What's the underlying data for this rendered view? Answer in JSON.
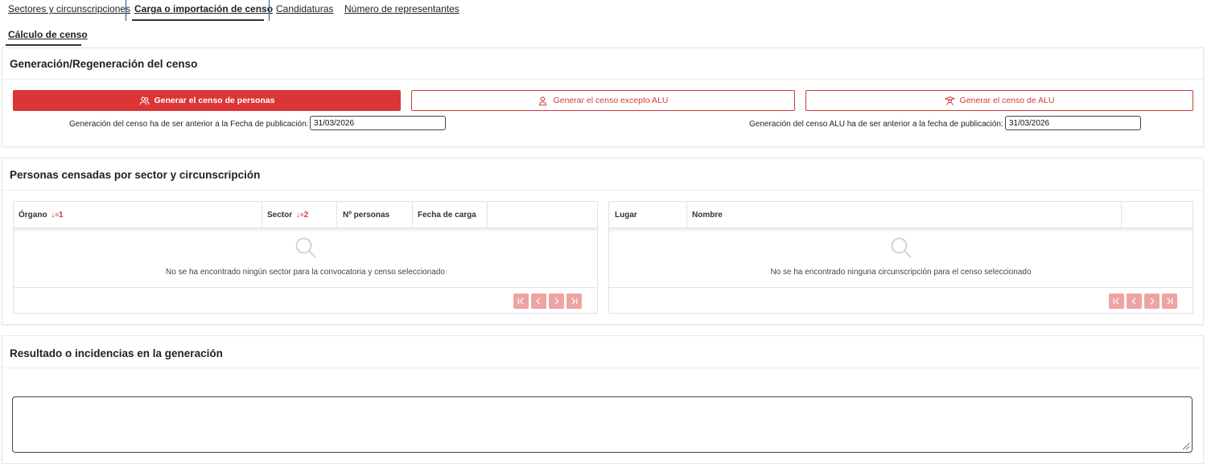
{
  "tabs": [
    {
      "label": "Sectores y circunscripciones",
      "active": false
    },
    {
      "label": "Carga o importación de censo",
      "active": true
    },
    {
      "label": "Candidaturas",
      "active": false
    },
    {
      "label": "Número de representantes",
      "active": false
    }
  ],
  "subtab": {
    "label": "Cálculo de censo"
  },
  "generation": {
    "title": "Generación/Regeneración del censo",
    "btn_personas": "Generar el censo de personas",
    "btn_excepto": "Generar el censo excepto ALU",
    "btn_alu": "Generar el censo de ALU",
    "label_censo": "Generación del censo ha de ser anterior a la Fecha de publicación:",
    "value_censo": "31/03/2026",
    "label_alu": "Generación del censo ALU ha de ser anterior a la fecha de publicación:",
    "value_alu": "31/03/2026"
  },
  "personas": {
    "title": "Personas censadas por sector y circunscripción",
    "left_table": {
      "col_organo": "Órgano",
      "sort_organo": "1",
      "col_sector": "Sector",
      "sort_sector": "2",
      "col_personas": "Nº personas",
      "col_fecha": "Fecha de carga",
      "empty": "No se ha encontrado ningún sector para la convocatoria y censo seleccionado"
    },
    "right_table": {
      "col_lugar": "Lugar",
      "col_nombre": "Nombre",
      "empty": "No se ha encontrado ninguna circunscripción para el censo seleccionado"
    }
  },
  "resultado": {
    "title": "Resultado o incidencias en la generación",
    "value": ""
  },
  "colors": {
    "primary": "#db3535",
    "pager": "#eea3a3",
    "tab_separator": "#1a56b0"
  }
}
